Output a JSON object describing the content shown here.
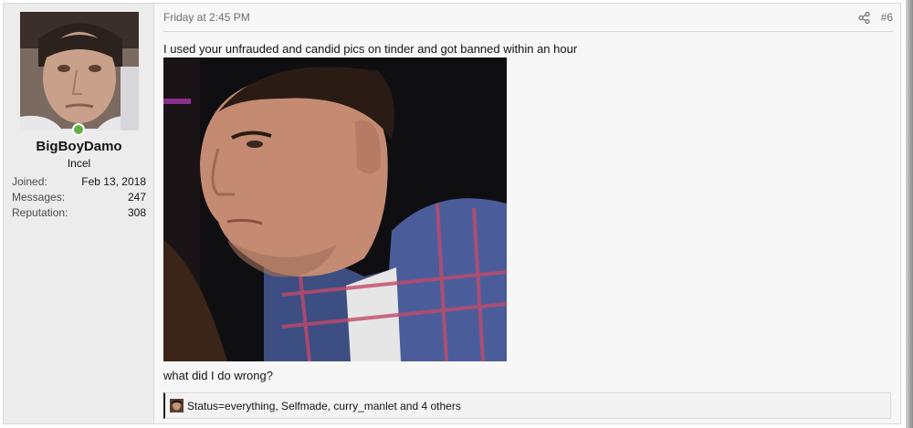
{
  "user": {
    "username": "BigBoyDamo",
    "title": "Incel",
    "stats": [
      {
        "label": "Joined:",
        "value": "Feb 13, 2018"
      },
      {
        "label": "Messages:",
        "value": "247"
      },
      {
        "label": "Reputation:",
        "value": "308"
      }
    ],
    "online_status_color": "#63b144"
  },
  "post": {
    "date": "Friday at 2:45 PM",
    "number": "#6",
    "share_icon": "share-icon",
    "text_top": "I used your unfrauded and candid pics on tinder and got banned within an hour",
    "text_bottom": "what did I do wrong?",
    "reactions_text": "Status=everything, Selfmade, curry_manlet and 4 others"
  }
}
